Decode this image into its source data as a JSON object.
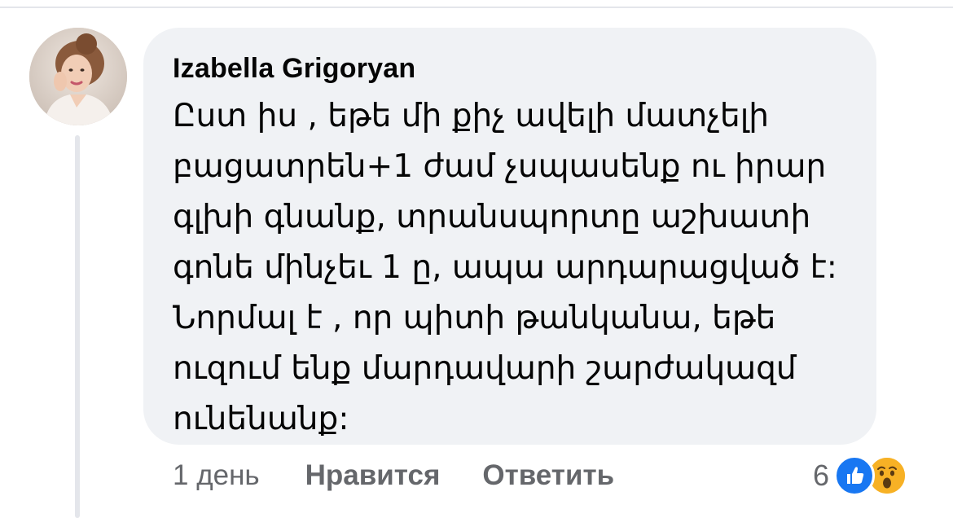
{
  "comment": {
    "author": "Izabella Grigoryan",
    "text": "Ըստ իս , եթե մի քիչ ավելի մատչելի\nբացատրեն+1 ժամ չսպասենք ու իրար\nգլխի գնանք, տրանսպորտը աշխատի\nգոնե մինչեւ 1 ը, ապա արդարացված է:\nՆորմալ է , որ պիտի թանկանա, եթե\nուզում ենք մարդավարի շարժակազմ\nունենանք:",
    "timestamp": "1 день",
    "like_label": "Нравится",
    "reply_label": "Ответить",
    "reaction_count": "6",
    "reactions": [
      "like-icon",
      "wow-icon"
    ]
  },
  "colors": {
    "bubble": "#f0f2f5",
    "text": "#050505",
    "secondary_text": "#65676b",
    "like_blue": "#1877f2",
    "wow_yellow": "#f7b125"
  }
}
